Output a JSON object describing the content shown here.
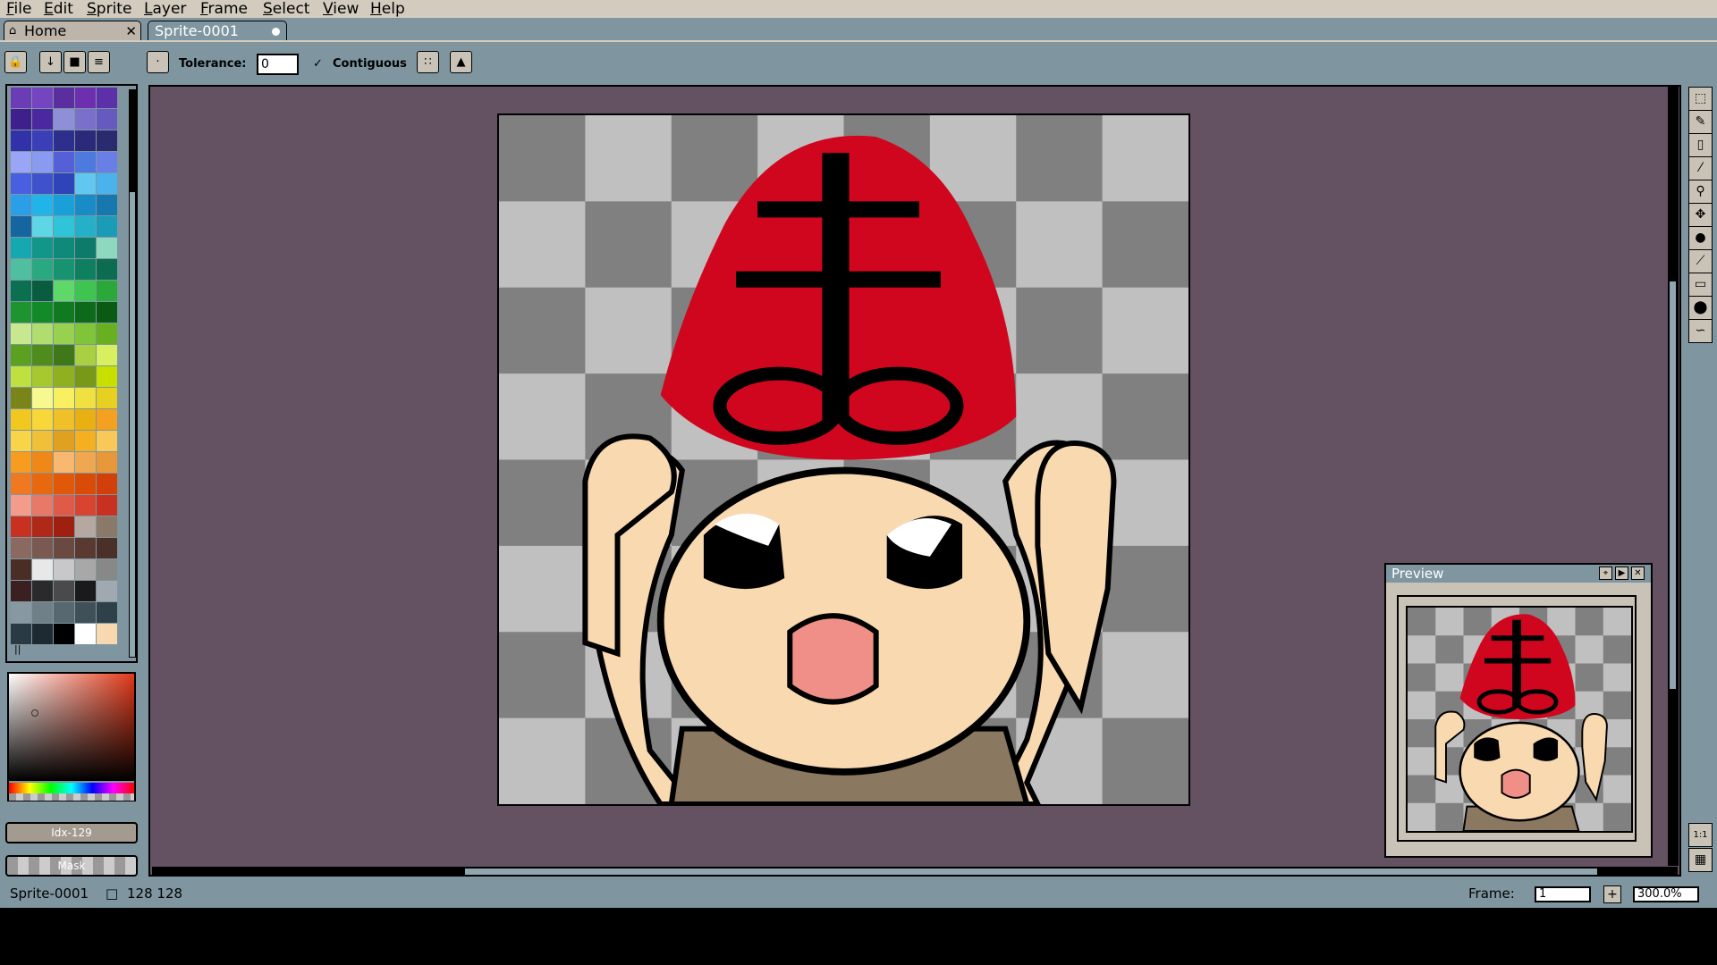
{
  "menu": [
    "File",
    "Edit",
    "Sprite",
    "Layer",
    "Frame",
    "Select",
    "View",
    "Help"
  ],
  "tabs": {
    "home": "Home",
    "sprite": "Sprite-0001"
  },
  "toolbar": {
    "tolerance_label": "Tolerance:",
    "tolerance_value": "0",
    "contiguous_label": "Contiguous",
    "contiguous_checked": true
  },
  "palette": {
    "rows": [
      [
        "#6a3db5",
        "#7544c0",
        "#5a2e9e",
        "#6d2fb0",
        "#5c30a8"
      ],
      [
        "#3f1f8a",
        "#4b28a0",
        "#8f8fd8",
        "#7b6fcc",
        "#6659c0"
      ],
      [
        "#3232a8",
        "#3a3fb8",
        "#2e2e8c",
        "#2b2a7a",
        "#2a2a6e"
      ],
      [
        "#9aa6f5",
        "#8a9af0",
        "#5560d8",
        "#4e7ae0",
        "#6a7fe6"
      ],
      [
        "#4a5fe0",
        "#3f52cc",
        "#2f44b8",
        "#62c7f0",
        "#4ab3ec"
      ],
      [
        "#2a9ee6",
        "#20b4e8",
        "#1aa0d8",
        "#198cc8",
        "#1778b0"
      ],
      [
        "#1565a0",
        "#5ed6e6",
        "#2fc4d8",
        "#24b0c8",
        "#1a9cb8"
      ],
      [
        "#16a8b0",
        "#12968a",
        "#0f8a7a",
        "#0d7a6a",
        "#8fd8c0"
      ],
      [
        "#4ec0a0",
        "#2aa880",
        "#169470",
        "#0e8060",
        "#0b6c50"
      ],
      [
        "#0a7050",
        "#095c40",
        "#5ed868",
        "#3fc450",
        "#2aa83a"
      ],
      [
        "#1e9430",
        "#128a28",
        "#0f7a20",
        "#0c6a1a",
        "#0a5a14"
      ],
      [
        "#c8e890",
        "#b0dc70",
        "#98d050",
        "#80c438",
        "#68b020"
      ],
      [
        "#5ca020",
        "#4f8c1c",
        "#3f7818",
        "#a8d040",
        "#d8f060"
      ],
      [
        "#c0e040",
        "#a8c830",
        "#90b020",
        "#789818",
        "#c8e000"
      ],
      [
        "#7a8418",
        "#f8f890",
        "#f8f060",
        "#f0e040",
        "#e8d020"
      ],
      [
        "#f0c820",
        "#f8d838",
        "#f0c028",
        "#e8b010",
        "#f4a020"
      ],
      [
        "#f8d448",
        "#f0c038",
        "#e0a020",
        "#f4b020",
        "#f8c858"
      ],
      [
        "#f89c20",
        "#f08818",
        "#f8b870",
        "#f0a850",
        "#e89838"
      ],
      [
        "#f07820",
        "#e86810",
        "#e05808",
        "#d84c08",
        "#d04008"
      ],
      [
        "#f49c8c",
        "#e87868",
        "#e05a48",
        "#d84430",
        "#c83020"
      ],
      [
        "#c83020",
        "#b02818",
        "#a02010",
        "#b4a8a0",
        "#8a7868"
      ],
      [
        "#8a6a60",
        "#7a5a50",
        "#6a4a40",
        "#5a3a30",
        "#4a3028"
      ],
      [
        "#4a2e26",
        "#e8e8e8",
        "#c8c8c8",
        "#a8a8a8",
        "#888888"
      ],
      [
        "#3a2020",
        "#2a2a2a",
        "#4a4a4a",
        "#1a1a1a",
        "#a0a8b0"
      ],
      [
        "#8898a0",
        "#708088",
        "#586870",
        "#405058",
        "#304048"
      ],
      [
        "#2a3a42",
        "#1e2a32",
        "#000000",
        "#ffffff",
        "#f8d8b0"
      ]
    ]
  },
  "buttons": {
    "index": "Idx-129",
    "mask": "Mask"
  },
  "preview": {
    "title": "Preview"
  },
  "status": {
    "sprite_name": "Sprite-0001",
    "size": "128 128",
    "frame_label": "Frame:",
    "frame_value": "1",
    "zoom_value": "300.0%"
  },
  "tools": [
    "marquee-tool",
    "pencil-tool",
    "eraser-tool",
    "eyedropper-tool",
    "zoom-tool",
    "move-tool",
    "paint-bucket-tool",
    "line-tool",
    "rectangle-tool",
    "ellipse-tool",
    "contour-tool"
  ],
  "colors": {
    "canvas_bg": "#645262",
    "ui_bg": "#7f96a0",
    "menu_bg": "#d3cbbe",
    "hat_red": "#d0061e",
    "skin": "#f9d9b0",
    "body": "#8a7860",
    "mouth": "#f08f88"
  }
}
